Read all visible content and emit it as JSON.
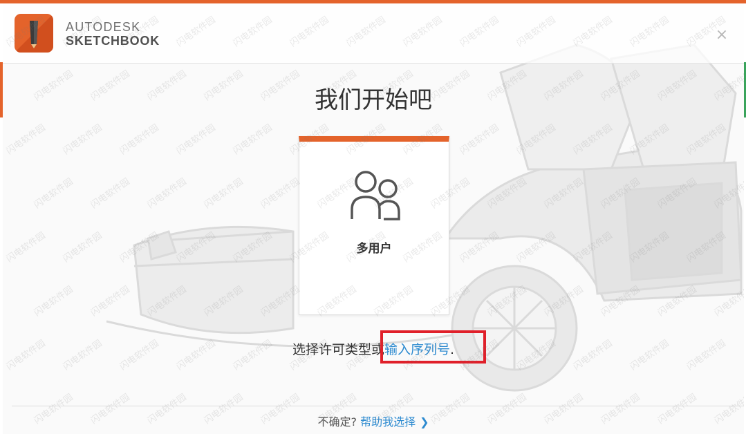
{
  "brand": {
    "line1": "AUTODESK",
    "line2": "SKETCHBOOK"
  },
  "close_label": "×",
  "title": "我们开始吧",
  "card": {
    "label": "多用户"
  },
  "license": {
    "prefix": "选择许可类型或",
    "serial_link": "输入序列号",
    "suffix": "."
  },
  "footer": {
    "question": "不确定?",
    "help_link": "帮助我选择",
    "chevron": "❯"
  },
  "watermark": "闪电软件园",
  "colors": {
    "accent": "#e4632b",
    "link": "#2e8bd0",
    "highlight": "#e0202a"
  },
  "icons": [
    "sketchbook-logo-icon",
    "close-icon",
    "multi-user-icon",
    "chevron-right-icon"
  ]
}
